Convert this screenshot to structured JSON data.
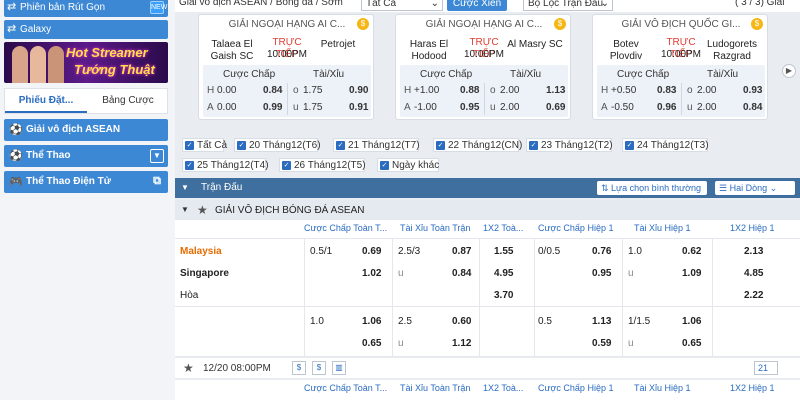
{
  "sidebar": {
    "top_buttons": [
      {
        "label": "Phiên bản Rút Gọn",
        "icon": "swap-icon",
        "badge": "NEW"
      },
      {
        "label": "Galaxy",
        "icon": "swap-icon"
      }
    ],
    "banner": {
      "line1": "Hot Streamer",
      "line2": "Tướng Thuật"
    },
    "tabs": [
      "Phiếu Đặt...",
      "Bảng Cược"
    ],
    "nav": [
      {
        "label": "Giải vô địch ASEAN",
        "icon": "soccer-ball-icon"
      },
      {
        "label": "Thể Thao",
        "icon": "sports-icon"
      },
      {
        "label": "Thể Thao Điện Tử",
        "icon": "gamepad-icon"
      }
    ]
  },
  "topbar": {
    "breadcrumb": "Giải vô địch ASEAN / Bóng đá / Sớm",
    "select1": "Tất Cả",
    "xien_button": "Cược Xiên",
    "select2": "Bộ Lọc Trận Đấu",
    "page_info": "( 3 / 3) Giải"
  },
  "cards": [
    {
      "league": "GIẢI NGOẠI HẠNG AI C...",
      "home": "Talaea El Gaish SC",
      "away": "Petrojet",
      "live": "TRỰC TIẾP",
      "time": "10:00PM",
      "h_label": "Cược Chấp",
      "ou_label": "Tài/Xỉu",
      "rows": [
        {
          "s": "H",
          "hline": "0.00",
          "hodd": "0.84",
          "ou": "o",
          "ouline": "1.75",
          "ouodd": "0.90"
        },
        {
          "s": "A",
          "hline": "0.00",
          "hodd": "0.99",
          "ou": "u",
          "ouline": "1.75",
          "ouodd": "0.91"
        }
      ]
    },
    {
      "league": "GIẢI NGOẠI HẠNG AI C...",
      "home": "Haras El Hodood",
      "away": "Al Masry SC",
      "live": "TRỰC TIẾP",
      "time": "10:00PM",
      "h_label": "Cược Chấp",
      "ou_label": "Tài/Xỉu",
      "rows": [
        {
          "s": "H",
          "hline": "+1.00",
          "hodd": "0.88",
          "ou": "o",
          "ouline": "2.00",
          "ouodd": "1.13"
        },
        {
          "s": "A",
          "hline": "-1.00",
          "hodd": "0.95",
          "ou": "u",
          "ouline": "2.00",
          "ouodd": "0.69"
        }
      ]
    },
    {
      "league": "GIẢI VÔ ĐỊCH QUỐC GI...",
      "home": "Botev Plovdiv",
      "away": "Ludogorets Razgrad",
      "live": "TRỰC TIẾP",
      "time": "10:00PM",
      "h_label": "Cược Chấp",
      "ou_label": "Tài/Xỉu",
      "rows": [
        {
          "s": "H",
          "hline": "+0.50",
          "hodd": "0.83",
          "ou": "o",
          "ouline": "2.00",
          "ouodd": "0.93"
        },
        {
          "s": "A",
          "hline": "-0.50",
          "hodd": "0.96",
          "ou": "u",
          "ouline": "2.00",
          "ouodd": "0.84"
        }
      ]
    }
  ],
  "date_filters": [
    "Tất Cả",
    "20 Tháng12(T6)",
    "21 Tháng12(T7)",
    "22 Tháng12(CN)",
    "23 Tháng12(T2)",
    "24 Tháng12(T3)",
    "25 Tháng12(T4)",
    "26 Tháng12(T5)",
    "Ngày khác"
  ],
  "table": {
    "title": "Trận Đấu",
    "sort_select": "Lựa chọn bình thường",
    "lines_select": "Hai Dòng",
    "league": "GIẢI VÔ ĐỊCH BÓNG ĐÁ ASEAN",
    "columns": [
      "Cược Chấp Toàn T...",
      "Tài Xỉu Toàn Trận",
      "1X2 Toà...",
      "Cược Chấp Hiệp 1",
      "Tài Xỉu Hiệp 1",
      "1X2 Hiệp 1"
    ],
    "teams": [
      "Malaysia",
      "Singapore",
      "Hòa"
    ],
    "main": {
      "hdp_line": "0.5/1",
      "hdp_home": "0.69",
      "hdp_away": "1.02",
      "ou_line": "2.5/3",
      "ou_u": "u",
      "ou_over": "0.87",
      "ou_under": "0.84",
      "x12": [
        "1.55",
        "4.95",
        "3.70"
      ],
      "h1_line": "0/0.5",
      "h1_home": "0.76",
      "h1_away": "0.95",
      "h1ou_line": "1.0",
      "h1ou_u": "u",
      "h1ou_over": "0.62",
      "h1ou_under": "1.09",
      "h1x12": [
        "2.13",
        "4.85",
        "2.22"
      ]
    },
    "alt": {
      "hdp_line": "1.0",
      "hdp_home": "1.06",
      "hdp_away": "0.65",
      "ou_line": "2.5",
      "ou_u": "u",
      "ou_over": "0.60",
      "ou_under": "1.12",
      "h1_line": "0.5",
      "h1_home": "1.13",
      "h1_away": "0.59",
      "h1ou_line": "1/1.5",
      "h1ou_u": "u",
      "h1ou_over": "1.06",
      "h1ou_under": "0.65"
    },
    "match_time": "12/20 08:00PM",
    "page_count": "21",
    "columns2": [
      "Cược Chấp Toàn T...",
      "Tài Xỉu Toàn Trận",
      "1X2 Toà...",
      "Cược Chấp Hiệp 1",
      "Tài Xỉu Hiệp 1",
      "1X2 Hiệp 1"
    ]
  },
  "colors": {
    "accent": "#3d88d4",
    "header": "#3f6f9e",
    "live": "#e03c31",
    "home_team": "#e56b00"
  }
}
